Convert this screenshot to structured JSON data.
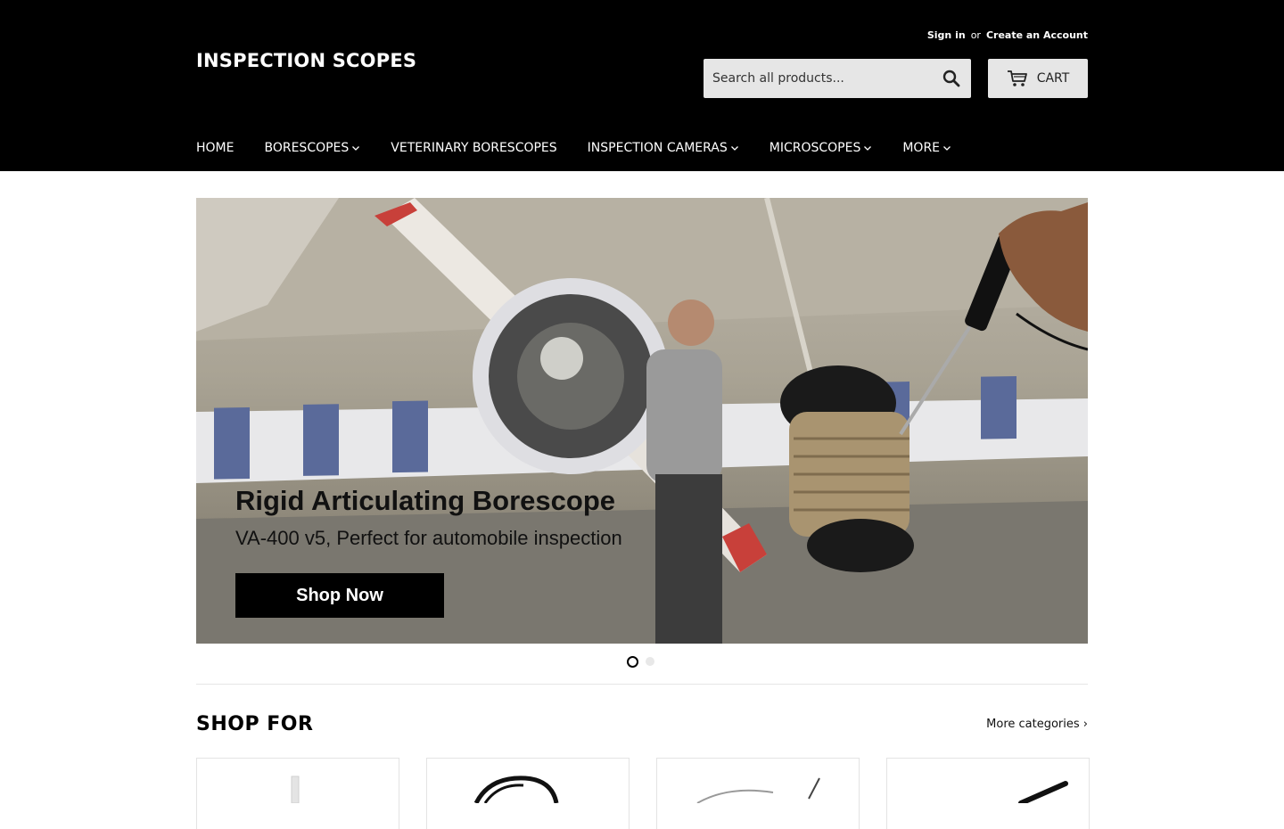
{
  "header": {
    "logo": "INSPECTION SCOPES",
    "sign_in": "Sign in",
    "or": "or",
    "create_account": "Create an Account",
    "search_placeholder": "Search all products...",
    "cart_label": "CART"
  },
  "nav": {
    "items": [
      {
        "label": "HOME",
        "dropdown": false
      },
      {
        "label": "BORESCOPES",
        "dropdown": true
      },
      {
        "label": "VETERINARY BORESCOPES",
        "dropdown": false
      },
      {
        "label": "INSPECTION CAMERAS",
        "dropdown": true
      },
      {
        "label": "MICROSCOPES",
        "dropdown": true
      },
      {
        "label": "MORE",
        "dropdown": true
      }
    ]
  },
  "hero": {
    "title": "Rigid Articulating Borescope",
    "subtitle": "VA-400 v5, Perfect for automobile inspection",
    "cta": "Shop Now",
    "slide_count": 2,
    "active_slide": 1
  },
  "shop": {
    "title": "SHOP FOR",
    "more_link": "More categories ›"
  },
  "colors": {
    "header_bg": "#000000",
    "button_bg": "#e6e6e6",
    "cta_bg": "#000000"
  }
}
